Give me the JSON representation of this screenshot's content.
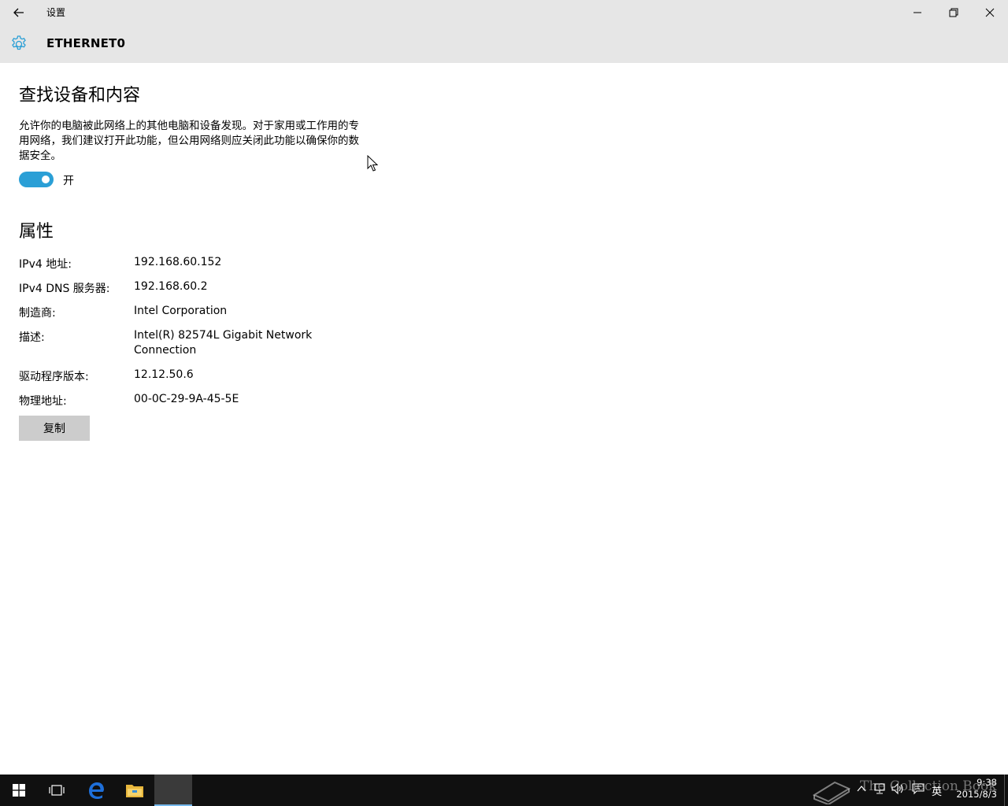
{
  "window": {
    "title": "设置",
    "back_icon": "back-arrow-icon",
    "controls": [
      "minimize-icon",
      "restore-icon",
      "close-icon"
    ]
  },
  "header": {
    "icon": "gear-icon",
    "title": "ETHERNET0",
    "accent_color": "#2a9fd6"
  },
  "discovery": {
    "heading": "查找设备和内容",
    "description": "允许你的电脑被此网络上的其他电脑和设备发现。对于家用或工作用的专用网络，我们建议打开此功能，但公用网络则应关闭此功能以确保你的数据安全。",
    "toggle_state": "on",
    "toggle_label": "开"
  },
  "properties": {
    "heading": "属性",
    "rows": [
      {
        "label": "IPv4 地址:",
        "value": "192.168.60.152"
      },
      {
        "label": "IPv4 DNS 服务器:",
        "value": "192.168.60.2"
      },
      {
        "label": "制造商:",
        "value": "Intel Corporation"
      },
      {
        "label": "描述:",
        "value": "Intel(R) 82574L Gigabit Network Connection"
      },
      {
        "label": "驱动程序版本:",
        "value": "12.12.50.6"
      },
      {
        "label": "物理地址:",
        "value": "00-0C-29-9A-45-5E"
      }
    ],
    "copy_label": "复制"
  },
  "taskbar": {
    "items": [
      "windows-start-icon",
      "task-view-icon",
      "edge-icon",
      "file-explorer-icon",
      "settings-app-active"
    ],
    "watermark": "The Collection Book",
    "ime": "英",
    "time": "9:38",
    "date": "2015/8/3"
  }
}
